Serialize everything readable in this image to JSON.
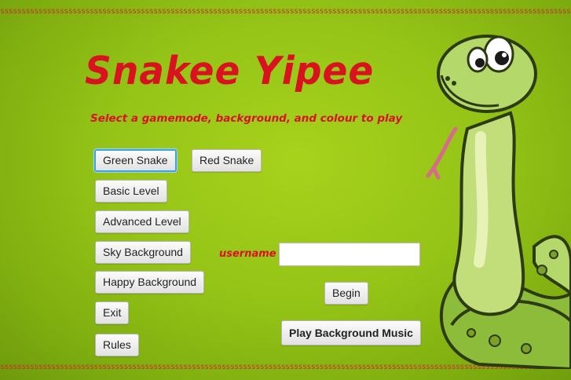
{
  "border": {
    "top_text": "ssssssssssssssssssssssssssssssssssssssssssssssssssssssssssssssssssssssssssssssssssssssssssssssssssssssssssssssssssssssssssssssssssssssssss",
    "bottom_text": "ssssssssssssssssssssssssssssssssssssssssssssssssssssssssssssssssssssssssssssssssssssssssssssssssssssssssssssssssssssssssssssssssssssssssss",
    "color": "#c6342b"
  },
  "header": {
    "title": "Snakee Yipee",
    "subtitle": "Select a gamemode, background, and colour to play",
    "accent_color": "#d8121f"
  },
  "buttons": {
    "green_snake": "Green Snake",
    "red_snake": "Red Snake",
    "basic_level": "Basic Level",
    "advanced_level": "Advanced Level",
    "sky_background": "Sky Background",
    "happy_background": "Happy Background",
    "exit": "Exit",
    "rules": "Rules",
    "begin": "Begin",
    "play_music": "Play Background Music"
  },
  "username": {
    "label": "username",
    "value": "",
    "placeholder": ""
  },
  "art": {
    "icon": "cartoon-snake"
  }
}
